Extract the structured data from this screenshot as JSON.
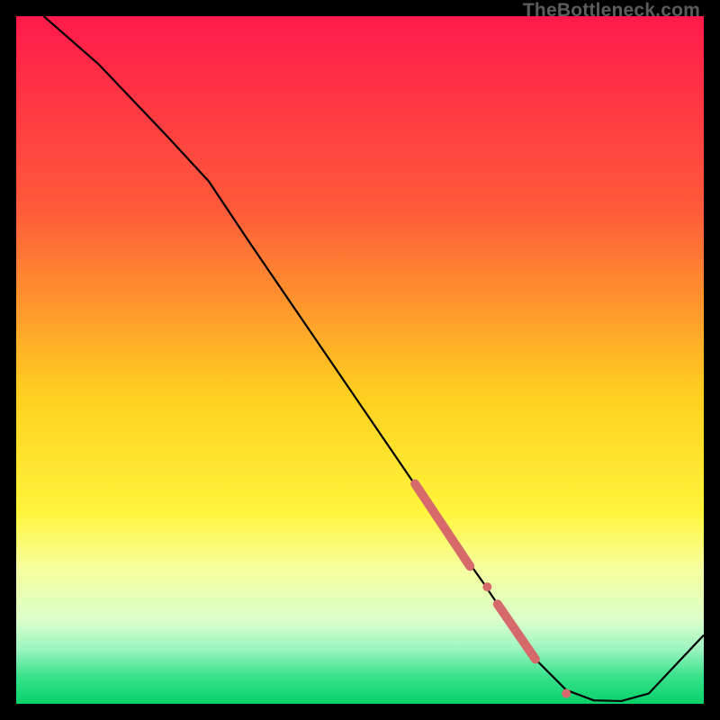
{
  "watermark": "TheBottleneck.com",
  "chart_data": {
    "type": "line",
    "title": "",
    "xlabel": "",
    "ylabel": "",
    "xlim": [
      0,
      100
    ],
    "ylim": [
      0,
      100
    ],
    "gradient_stops": [
      {
        "offset": 0,
        "color": "#ff1a4b"
      },
      {
        "offset": 28,
        "color": "#ff5a3a"
      },
      {
        "offset": 55,
        "color": "#ffcf20"
      },
      {
        "offset": 72,
        "color": "#fff53a"
      },
      {
        "offset": 80,
        "color": "#f7ff9c"
      },
      {
        "offset": 88,
        "color": "#d9ffca"
      },
      {
        "offset": 92,
        "color": "#9cf5c0"
      },
      {
        "offset": 96,
        "color": "#39e28c"
      },
      {
        "offset": 100,
        "color": "#07d169"
      }
    ],
    "series": [
      {
        "name": "bottleneck-curve",
        "x": [
          4,
          12,
          22,
          28,
          34,
          62,
          68,
          75,
          80,
          84,
          88,
          92,
          100
        ],
        "y": [
          100,
          93,
          82.5,
          76,
          67,
          26,
          17.5,
          7,
          2,
          0.5,
          0.4,
          1.5,
          10
        ]
      }
    ],
    "markers": [
      {
        "name": "marker-segment-upper",
        "x_range": [
          58,
          66
        ],
        "y_range": [
          32,
          20
        ],
        "type": "thick-line"
      },
      {
        "name": "marker-dot-mid",
        "x": 68.5,
        "y": 17,
        "type": "dot"
      },
      {
        "name": "marker-segment-lower",
        "x_range": [
          70,
          75.5
        ],
        "y_range": [
          14.5,
          6.5
        ],
        "type": "thick-line"
      },
      {
        "name": "marker-dot-bottom",
        "x": 80,
        "y": 1.5,
        "type": "dot"
      }
    ],
    "marker_color": "#d66a6a"
  }
}
